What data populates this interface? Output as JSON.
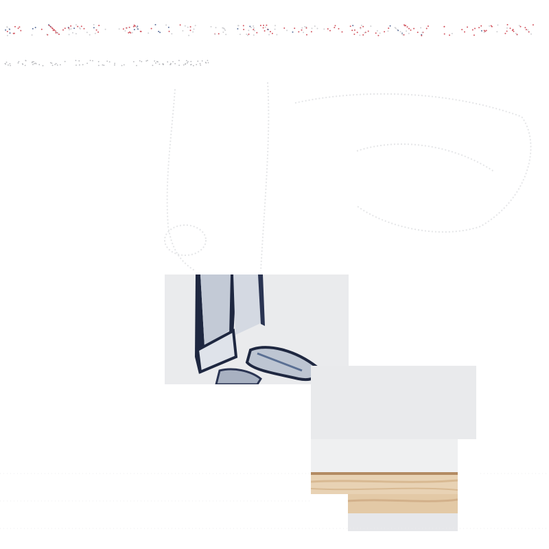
{
  "scene": {
    "description_free": true,
    "colors": {
      "background": "#ffffff",
      "canvas_white": "#e9eaec",
      "canvas_light": "#eff0f1",
      "ink_navy": "#1e2740",
      "ink_blue": "#5a6f93",
      "paint_grey": "#b9c2cf",
      "wood_light": "#e8d2b4",
      "wood_mid": "#d8b992",
      "wood_dark": "#b38b63",
      "header_dots_red": "#d2555f",
      "header_dots_blue": "#5b6f9a"
    }
  }
}
